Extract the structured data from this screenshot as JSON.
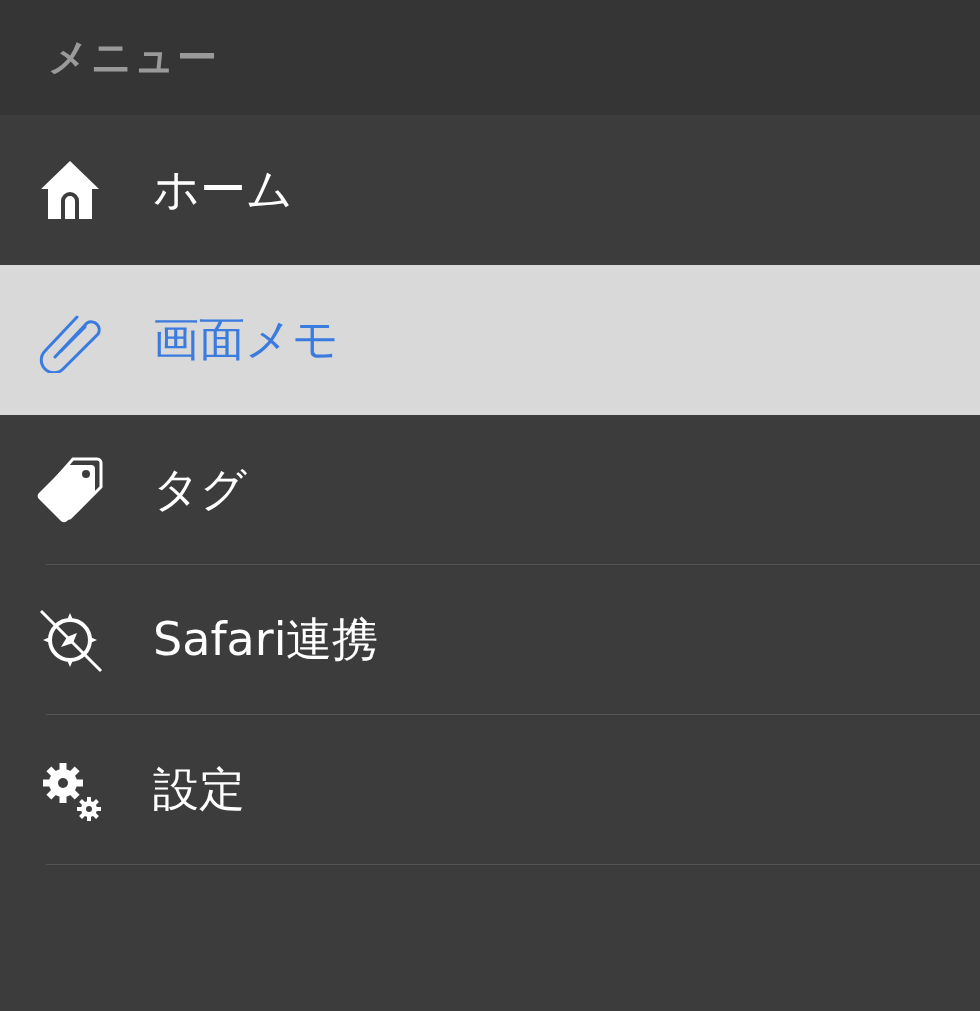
{
  "header": {
    "title": "メニュー"
  },
  "menu": [
    {
      "kind": "home",
      "label": "ホーム",
      "selected": false
    },
    {
      "kind": "clip",
      "label": "画面メモ",
      "selected": true
    },
    {
      "kind": "tag",
      "label": "タグ",
      "selected": false
    },
    {
      "kind": "compass",
      "label": "Safari連携",
      "selected": false
    },
    {
      "kind": "gear",
      "label": "設定",
      "selected": false
    }
  ]
}
